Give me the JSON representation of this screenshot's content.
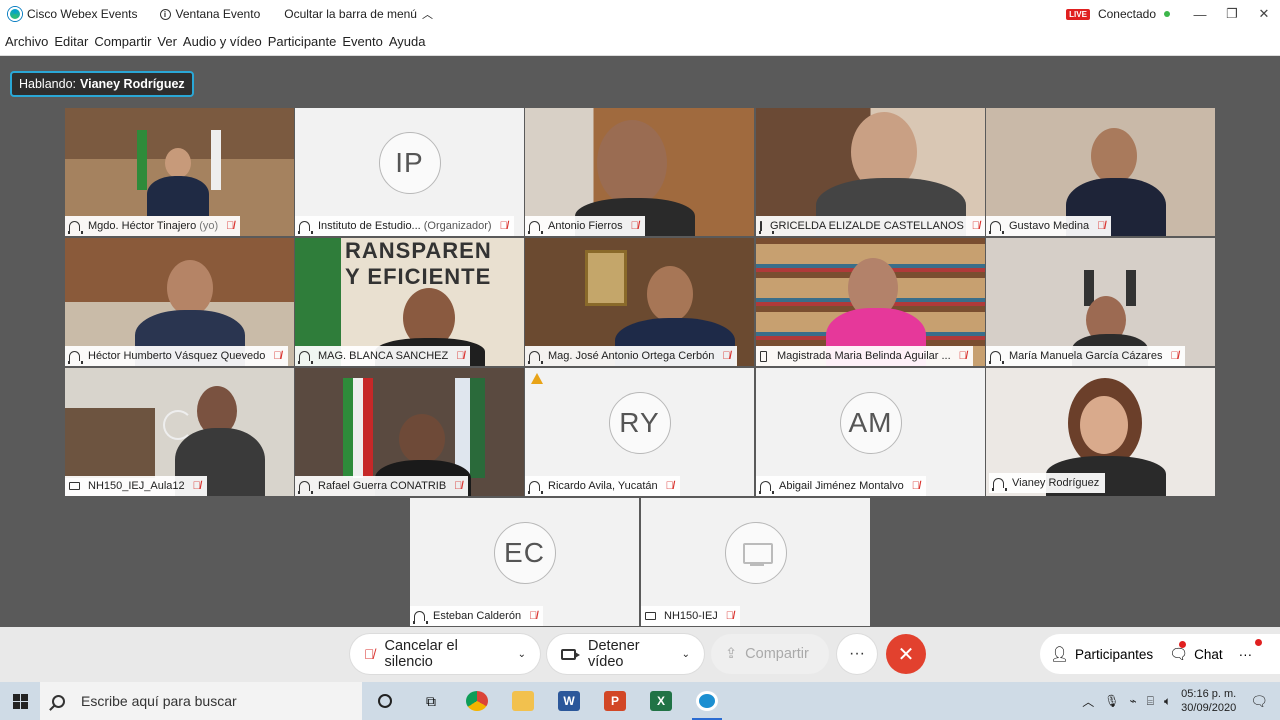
{
  "titlebar": {
    "app_title": "Cisco Webex Events",
    "window_label": "Ventana Evento",
    "hide_menu_label": "Ocultar la barra de menú",
    "live": "LIVE",
    "status": "Conectado",
    "status_color": "#3cb64a"
  },
  "menu": [
    "Archivo",
    "Editar",
    "Compartir",
    "Ver",
    "Audio y vídeo",
    "Participante",
    "Evento",
    "Ayuda"
  ],
  "speaking": {
    "prefix": "Hablando:",
    "name": "Vianey Rodríguez"
  },
  "tiles": [
    {
      "name": "Mgdo. Héctor Tinajero",
      "suffix": "(yo)",
      "kind": "video",
      "device": "headset"
    },
    {
      "name": "Instituto de Estudio...",
      "suffix": "(Organizador)",
      "kind": "avatar",
      "initials": "IP",
      "device": "headset"
    },
    {
      "name": "Antonio Fierros",
      "kind": "video",
      "device": "headset"
    },
    {
      "name": "GRICELDA ELIZALDE CASTELLANOS",
      "kind": "video",
      "device": "headset"
    },
    {
      "name": "Gustavo Medina",
      "kind": "video",
      "device": "headset"
    },
    {
      "name": "Héctor Humberto Vásquez Quevedo",
      "kind": "video",
      "device": "headset"
    },
    {
      "name": "MAG. BLANCA SANCHEZ",
      "kind": "video",
      "device": "headset"
    },
    {
      "name": "Mag. José Antonio Ortega Cerbón",
      "kind": "video",
      "device": "headset"
    },
    {
      "name": "Magistrada Maria Belinda Aguilar ...",
      "kind": "video",
      "device": "phone"
    },
    {
      "name": "María Manuela García Cázares",
      "kind": "video",
      "device": "headset"
    },
    {
      "name": "NH150_IEJ_Aula12",
      "kind": "video",
      "device": "room"
    },
    {
      "name": "Rafael Guerra CONATRIB",
      "kind": "video",
      "device": "headset"
    },
    {
      "name": "Ricardo Avila, Yucatán",
      "kind": "avatar",
      "initials": "RY",
      "device": "headset",
      "warning": true
    },
    {
      "name": "Abigail Jiménez Montalvo",
      "kind": "avatar",
      "initials": "AM",
      "device": "headset"
    },
    {
      "name": "Vianey Rodríguez",
      "kind": "video",
      "device": "headset",
      "active": true
    },
    {
      "name": "Esteban Calderón",
      "kind": "avatar",
      "initials": "EC",
      "device": "headset"
    },
    {
      "name": "NH150-IEJ",
      "kind": "screen",
      "device": "room"
    }
  ],
  "controls": {
    "unmute": "Cancelar el silencio",
    "stop_video": "Detener vídeo",
    "share": "Compartir",
    "more": "···",
    "participants": "Participantes",
    "chat": "Chat"
  },
  "taskbar": {
    "search_placeholder": "Escribe aquí para buscar",
    "time": "05:16 p. m.",
    "date": "30/09/2020"
  },
  "colors": {
    "accent": "#2aa7d6",
    "end_call": "#e2412e",
    "mute_red": "#d9302c"
  }
}
